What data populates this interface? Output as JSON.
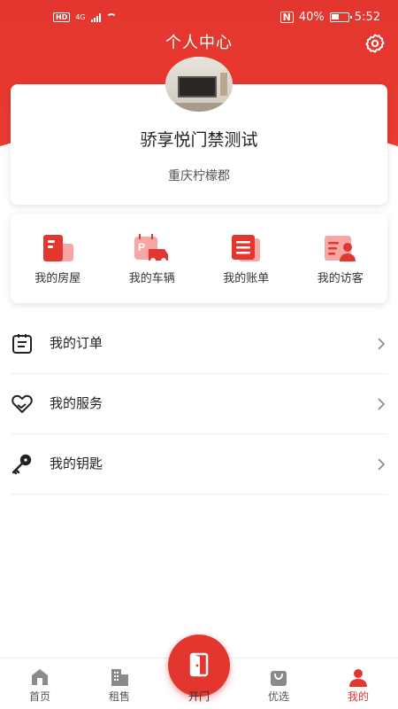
{
  "status_bar": {
    "battery": "40%",
    "time": "5:52",
    "network": "4G",
    "hd": "HD",
    "nfc": "N"
  },
  "header": {
    "title": "个人中心"
  },
  "profile": {
    "name": "骄享悦门禁测试",
    "community": "重庆柠檬郡"
  },
  "quick_actions": [
    {
      "label": "我的房屋",
      "icon": "house-icon"
    },
    {
      "label": "我的车辆",
      "icon": "parking-car-icon"
    },
    {
      "label": "我的账单",
      "icon": "bill-icon"
    },
    {
      "label": "我的访客",
      "icon": "visitor-icon"
    }
  ],
  "menu": [
    {
      "label": "我的订单",
      "icon": "order-clipboard-icon"
    },
    {
      "label": "我的服务",
      "icon": "heart-hand-icon"
    },
    {
      "label": "我的钥匙",
      "icon": "key-icon"
    }
  ],
  "tabbar": {
    "items": [
      {
        "label": "首页",
        "icon": "home-icon"
      },
      {
        "label": "租售",
        "icon": "building-icon"
      },
      {
        "label": "开门",
        "icon": "door-icon"
      },
      {
        "label": "优选",
        "icon": "shopping-bag-icon"
      },
      {
        "label": "我的",
        "icon": "person-icon"
      }
    ],
    "active": "我的"
  },
  "colors": {
    "primary": "#e3362e",
    "icon_light": "#f6a7a3",
    "text": "#222222",
    "muted": "#555555"
  }
}
